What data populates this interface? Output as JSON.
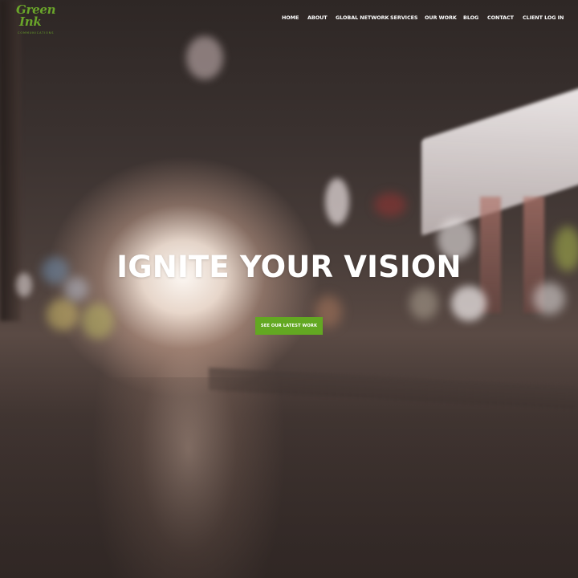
{
  "logo": {
    "line1": "Green",
    "line2": "Ink",
    "tagline": "COMMUNICATIONS",
    "color": "#6aa52a"
  },
  "nav": {
    "items": [
      {
        "label": "HOME"
      },
      {
        "label": "ABOUT"
      },
      {
        "label": "GLOBAL NETWORK"
      },
      {
        "label": "SERVICES"
      },
      {
        "label": "OUR WORK"
      },
      {
        "label": "BLOG"
      },
      {
        "label": "CONTACT"
      },
      {
        "label": "CLIENT LOG IN"
      }
    ]
  },
  "hero": {
    "headline": "IGNITE YOUR VISION",
    "cta_label": "SEE OUR LATEST WORK",
    "cta_color": "#63a822"
  }
}
